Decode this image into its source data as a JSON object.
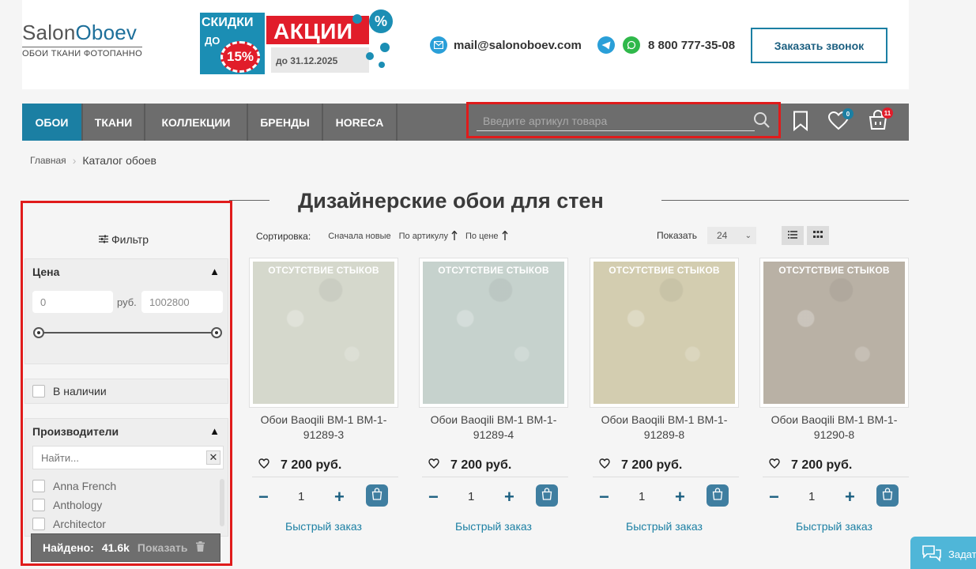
{
  "header": {
    "logo_main_a": "Salon",
    "logo_main_b": "Oboev",
    "logo_sub": "ОБОИ ТКАНИ ФОТОПАННО",
    "promo": {
      "skidki": "СКИДКИ",
      "do": "ДО",
      "percent": "15%",
      "akcii": "АКЦИИ",
      "date": "до 31.12.2025",
      "pct_badge": "%"
    },
    "email": "mail@salonoboev.com",
    "phone": "8 800 777-35-08",
    "call_button": "Заказать звонок"
  },
  "nav": {
    "items": [
      {
        "label": "ОБОИ",
        "active": true
      },
      {
        "label": "ТКАНИ",
        "active": false
      },
      {
        "label": "КОЛЛЕКЦИИ",
        "active": false
      },
      {
        "label": "БРЕНДЫ",
        "active": false
      },
      {
        "label": "HORECA",
        "active": false
      }
    ],
    "search_placeholder": "Введите артикул товара",
    "favorites_count": "0",
    "cart_count": "11"
  },
  "breadcrumb": {
    "home": "Главная",
    "current": "Каталог обоев"
  },
  "page_title": "Дизайнерские обои для стен",
  "filter": {
    "title": "Фильтр",
    "price": {
      "label": "Цена",
      "min": "0",
      "currency": "руб.",
      "max": "1002800"
    },
    "in_stock_label": "В наличии",
    "manufacturers": {
      "label": "Производители",
      "search_placeholder": "Найти...",
      "items": [
        "Anna French",
        "Anthology",
        "Architector"
      ]
    },
    "found_label": "Найдено:",
    "found_count": "41.6k",
    "show_label": "Показать"
  },
  "sort": {
    "label": "Сортировка:",
    "options": [
      "Сначала новые",
      "По артикулу",
      "По цене"
    ],
    "show_label": "Показать",
    "per_page": "24"
  },
  "products": [
    {
      "tag": "ОТСУТСТВИЕ СТЫКОВ",
      "name_line1": "Обои Baoqili BM-1 BM-1-",
      "name_line2": "91289-3",
      "price": "7 200 руб.",
      "qty": "1",
      "quick": "Быстрый заказ",
      "color": "#d5d8cc"
    },
    {
      "tag": "ОТСУТСТВИЕ СТЫКОВ",
      "name_line1": "Обои Baoqili BM-1 BM-1-",
      "name_line2": "91289-4",
      "price": "7 200 руб.",
      "qty": "1",
      "quick": "Быстрый заказ",
      "color": "#c6d2cd"
    },
    {
      "tag": "ОТСУТСТВИЕ СТЫКОВ",
      "name_line1": "Обои Baoqili BM-1 BM-1-",
      "name_line2": "91289-8",
      "price": "7 200 руб.",
      "qty": "1",
      "quick": "Быстрый заказ",
      "color": "#d3cdb0"
    },
    {
      "tag": "ОТСУТСТВИЕ СТЫКОВ",
      "name_line1": "Обои Baoqili BM-1 BM-1-",
      "name_line2": "91290-8",
      "price": "7 200 руб.",
      "qty": "1",
      "quick": "Быстрый заказ",
      "color": "#b9b1a5"
    }
  ],
  "chat_label": "Задать",
  "colors": {
    "accent": "#1b7fa3",
    "nav_bg": "#6d6d6d",
    "highlight": "#e01b1b",
    "promo_red": "#e11d2a"
  }
}
